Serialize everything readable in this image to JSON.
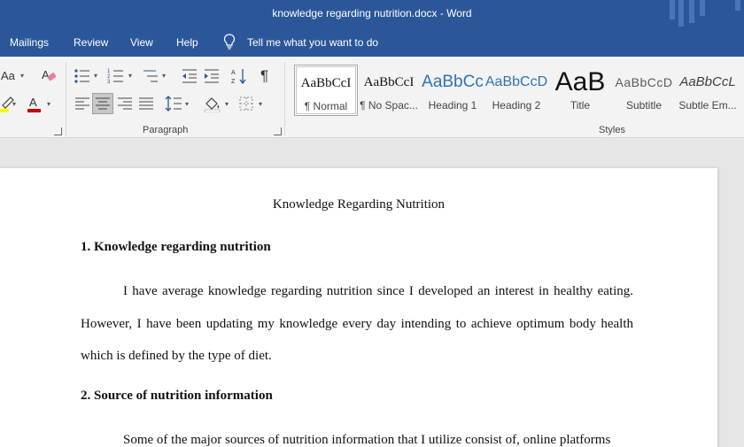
{
  "window": {
    "title": "knowledge regarding nutrition.docx  -  Word"
  },
  "tabs": [
    {
      "label": "Mailings"
    },
    {
      "label": "Review"
    },
    {
      "label": "View"
    },
    {
      "label": "Help"
    }
  ],
  "tell_me": {
    "label": "Tell me what you want to do",
    "icon": "lightbulb-icon"
  },
  "ribbon": {
    "font_group": {
      "change_case_label": "Aa",
      "font_color": "#c00000",
      "highlight_color": "#ffff00"
    },
    "paragraph_group": {
      "label": "Paragraph",
      "show_marks_glyph": "¶"
    },
    "styles_group": {
      "label": "Styles",
      "styles": [
        {
          "sample": "AaBbCcI",
          "name": "¶ Normal",
          "selected": true
        },
        {
          "sample": "AaBbCcI",
          "name": "¶ No Spac..."
        },
        {
          "sample": "AaBbCc",
          "name": "Heading 1"
        },
        {
          "sample": "AaBbCcD",
          "name": "Heading 2"
        },
        {
          "sample": "AaB",
          "name": "Title"
        },
        {
          "sample": "AaBbCcD",
          "name": "Subtitle"
        },
        {
          "sample": "AaBbCcL",
          "name": "Subtle Em..."
        }
      ]
    }
  },
  "document": {
    "title": "Knowledge Regarding Nutrition",
    "sections": [
      {
        "heading": "1. Knowledge regarding nutrition",
        "paragraph": "I have average knowledge regarding nutrition since I developed an interest in healthy eating. However, I have been updating my knowledge every day intending to achieve optimum body health which is defined by the type of diet."
      },
      {
        "heading": "2. Source of nutrition information",
        "paragraph": "Some of the major sources of nutrition information that I utilize consist of, online platforms"
      }
    ]
  }
}
